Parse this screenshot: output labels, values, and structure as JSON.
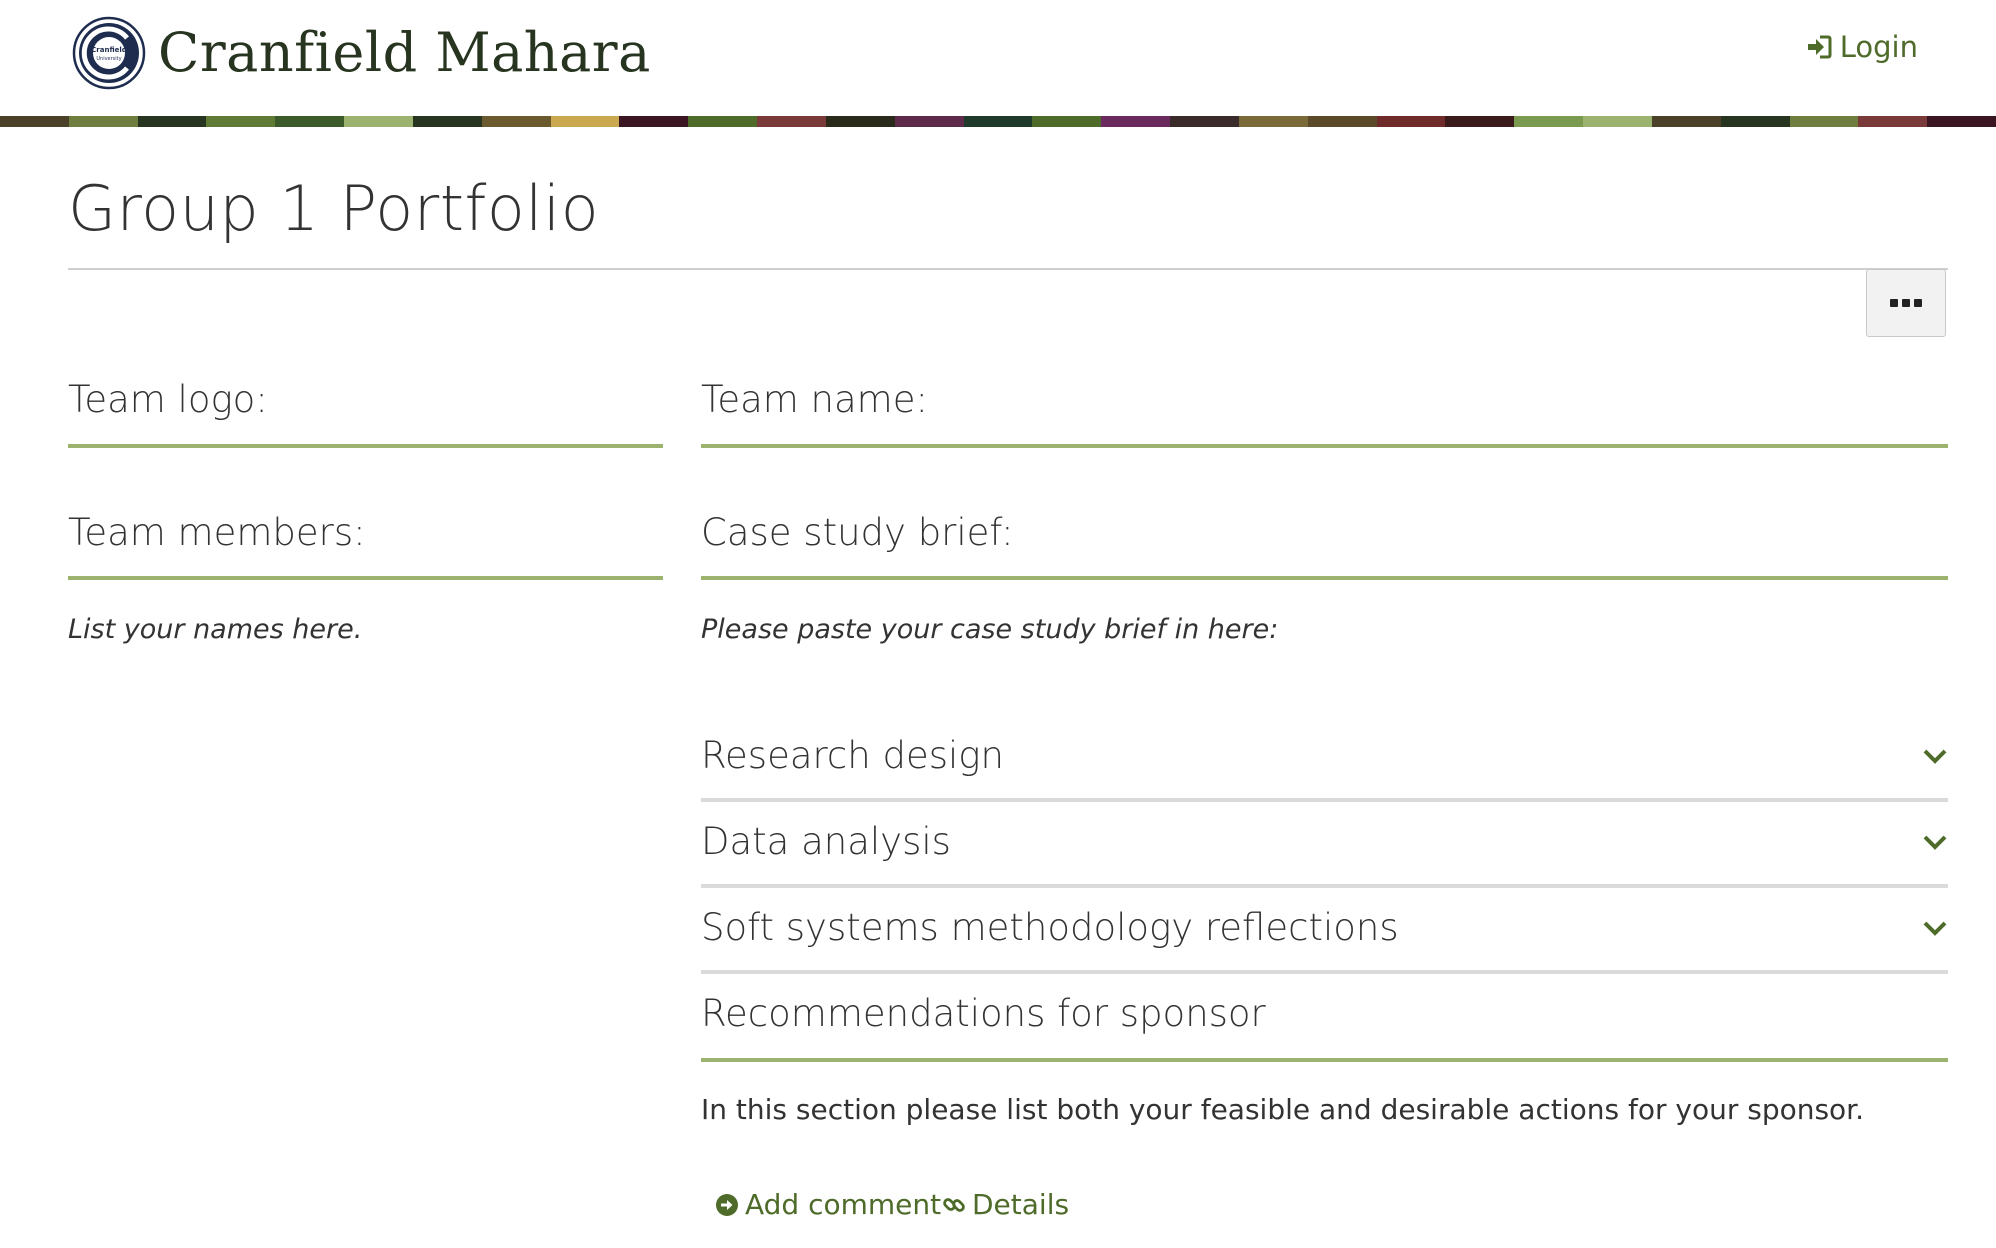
{
  "header": {
    "site_title": "Cranfield Mahara",
    "logo_text_line1": "Cranfield",
    "logo_text_line2": "University",
    "login_label": "Login",
    "stripe_colors": [
      "#4a4128",
      "#6f7d3f",
      "#27341f",
      "#5e7a34",
      "#3d5a2a",
      "#9bb36e",
      "#27341f",
      "#6b5a2e",
      "#c9a84f",
      "#3a1622",
      "#4f6b2a",
      "#7a3a3a",
      "#2a2a1a",
      "#5e2a4a",
      "#1f3a2a",
      "#4f6b2a",
      "#6b2a5e",
      "#3a2a2a",
      "#7a6a3a",
      "#5a4a2a",
      "#6f2a2a",
      "#3a1a1a",
      "#7a9a4f",
      "#9bb36e",
      "#4a4128",
      "#27341f",
      "#6f7d3f",
      "#7a3a3a",
      "#3a1622"
    ]
  },
  "page": {
    "title": "Group 1 Portfolio",
    "more_button_label": "More options"
  },
  "blocks": {
    "team_logo": {
      "title": "Team logo:"
    },
    "team_name": {
      "title": "Team name:"
    },
    "team_members": {
      "title": "Team members:",
      "text": "List your names here."
    },
    "case_study": {
      "title": "Case study brief:",
      "text": "Please paste your case study brief in here:"
    }
  },
  "accordion": [
    {
      "label": "Research design",
      "icon": "chevron-down-icon"
    },
    {
      "label": "Data analysis",
      "icon": "chevron-down-icon"
    },
    {
      "label": "Soft systems methodology reflections",
      "icon": "chevron-down-icon"
    }
  ],
  "recommendations": {
    "title": "Recommendations for sponsor",
    "text": "In this section please list both your feasible and desirable actions for your sponsor.",
    "add_comment_label": "Add comment",
    "details_label": "Details"
  },
  "colors": {
    "accent": "#4f6b2a",
    "rule_green": "#9bb36e",
    "rule_grey": "#dadada"
  }
}
